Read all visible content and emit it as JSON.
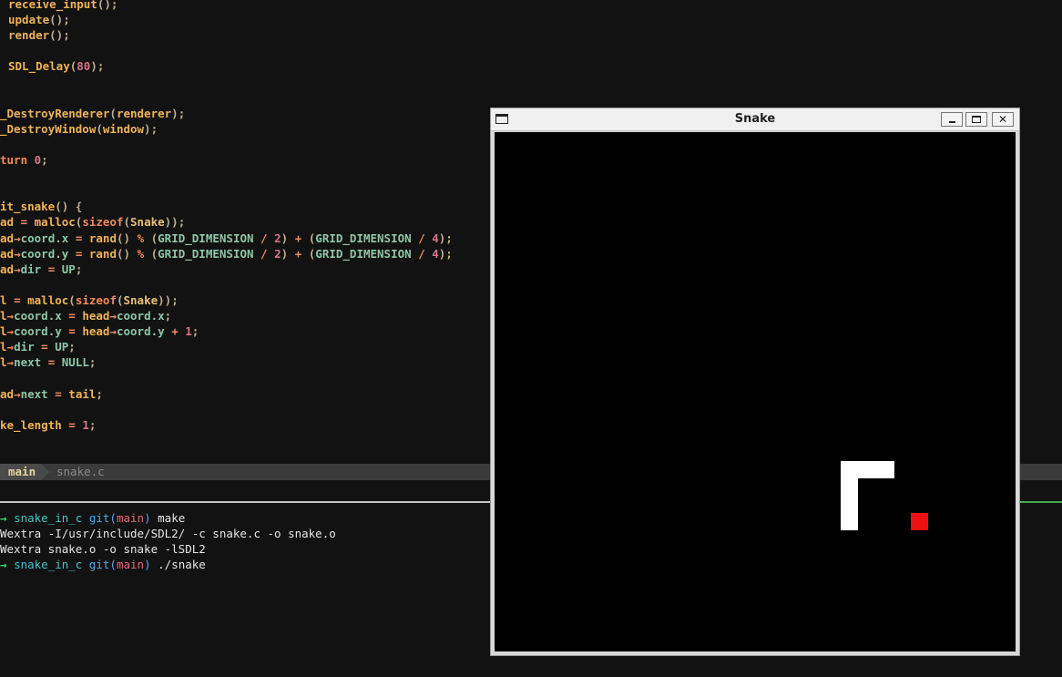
{
  "editor": {
    "lines": [
      [
        [
          "tok-fn",
          "receive_input"
        ],
        [
          "tok-pun",
          "();"
        ]
      ],
      [
        [
          "tok-fn",
          "update"
        ],
        [
          "tok-pun",
          "();"
        ]
      ],
      [
        [
          "tok-fn",
          "render"
        ],
        [
          "tok-pun",
          "();"
        ]
      ],
      [],
      [
        [
          "tok-fn",
          "SDL_Delay"
        ],
        [
          "tok-pun",
          "("
        ],
        [
          "tok-num",
          "80"
        ],
        [
          "tok-pun",
          ");"
        ]
      ],
      [],
      [],
      [
        [
          "tok-fn",
          "_DestroyRenderer"
        ],
        [
          "tok-pun",
          "("
        ],
        [
          "tok-id",
          "renderer"
        ],
        [
          "tok-pun",
          ");"
        ]
      ],
      [
        [
          "tok-fn",
          "_DestroyWindow"
        ],
        [
          "tok-pun",
          "("
        ],
        [
          "tok-id",
          "window"
        ],
        [
          "tok-pun",
          ");"
        ]
      ],
      [],
      [
        [
          "tok-kw",
          "turn "
        ],
        [
          "tok-num",
          "0"
        ],
        [
          "tok-pun",
          ";"
        ]
      ],
      [],
      [],
      [
        [
          "tok-fn",
          "it_snake"
        ],
        [
          "tok-pun",
          "() {"
        ]
      ],
      [
        [
          "tok-id",
          "ad "
        ],
        [
          "tok-op",
          "= "
        ],
        [
          "tok-fn",
          "malloc"
        ],
        [
          "tok-pun",
          "("
        ],
        [
          "tok-kw",
          "sizeof"
        ],
        [
          "tok-pun",
          "("
        ],
        [
          "tok-type",
          "Snake"
        ],
        [
          "tok-pun",
          "));"
        ]
      ],
      [
        [
          "tok-id",
          "ad"
        ],
        [
          "tok-op",
          "→"
        ],
        [
          "tok-mem",
          "coord.x "
        ],
        [
          "tok-op",
          "= "
        ],
        [
          "tok-fn",
          "rand"
        ],
        [
          "tok-pun",
          "() "
        ],
        [
          "tok-op",
          "% "
        ],
        [
          "tok-pun",
          "("
        ],
        [
          "tok-const",
          "GRID_DIMENSION "
        ],
        [
          "tok-op",
          "/ "
        ],
        [
          "tok-num",
          "2"
        ],
        [
          "tok-pun",
          ") "
        ],
        [
          "tok-op",
          "+ "
        ],
        [
          "tok-pun",
          "("
        ],
        [
          "tok-const",
          "GRID_DIMENSION "
        ],
        [
          "tok-op",
          "/ "
        ],
        [
          "tok-num",
          "4"
        ],
        [
          "tok-pun",
          ");"
        ]
      ],
      [
        [
          "tok-id",
          "ad"
        ],
        [
          "tok-op",
          "→"
        ],
        [
          "tok-mem",
          "coord.y "
        ],
        [
          "tok-op",
          "= "
        ],
        [
          "tok-fn",
          "rand"
        ],
        [
          "tok-pun",
          "() "
        ],
        [
          "tok-op",
          "% "
        ],
        [
          "tok-pun",
          "("
        ],
        [
          "tok-const",
          "GRID_DIMENSION "
        ],
        [
          "tok-op",
          "/ "
        ],
        [
          "tok-num",
          "2"
        ],
        [
          "tok-pun",
          ") "
        ],
        [
          "tok-op",
          "+ "
        ],
        [
          "tok-pun",
          "("
        ],
        [
          "tok-const",
          "GRID_DIMENSION "
        ],
        [
          "tok-op",
          "/ "
        ],
        [
          "tok-num",
          "4"
        ],
        [
          "tok-pun",
          ");"
        ]
      ],
      [
        [
          "tok-id",
          "ad"
        ],
        [
          "tok-op",
          "→"
        ],
        [
          "tok-mem",
          "dir "
        ],
        [
          "tok-op",
          "= "
        ],
        [
          "tok-const",
          "UP"
        ],
        [
          "tok-pun",
          ";"
        ]
      ],
      [],
      [
        [
          "tok-id",
          "l "
        ],
        [
          "tok-op",
          "= "
        ],
        [
          "tok-fn",
          "malloc"
        ],
        [
          "tok-pun",
          "("
        ],
        [
          "tok-kw",
          "sizeof"
        ],
        [
          "tok-pun",
          "("
        ],
        [
          "tok-type",
          "Snake"
        ],
        [
          "tok-pun",
          "));"
        ]
      ],
      [
        [
          "tok-id",
          "l"
        ],
        [
          "tok-op",
          "→"
        ],
        [
          "tok-mem",
          "coord.x "
        ],
        [
          "tok-op",
          "= "
        ],
        [
          "tok-id",
          "head"
        ],
        [
          "tok-op",
          "→"
        ],
        [
          "tok-mem",
          "coord.x"
        ],
        [
          "tok-pun",
          ";"
        ]
      ],
      [
        [
          "tok-id",
          "l"
        ],
        [
          "tok-op",
          "→"
        ],
        [
          "tok-mem",
          "coord.y "
        ],
        [
          "tok-op",
          "= "
        ],
        [
          "tok-id",
          "head"
        ],
        [
          "tok-op",
          "→"
        ],
        [
          "tok-mem",
          "coord.y "
        ],
        [
          "tok-op",
          "+ "
        ],
        [
          "tok-num",
          "1"
        ],
        [
          "tok-pun",
          ";"
        ]
      ],
      [
        [
          "tok-id",
          "l"
        ],
        [
          "tok-op",
          "→"
        ],
        [
          "tok-mem",
          "dir "
        ],
        [
          "tok-op",
          "= "
        ],
        [
          "tok-const",
          "UP"
        ],
        [
          "tok-pun",
          ";"
        ]
      ],
      [
        [
          "tok-id",
          "l"
        ],
        [
          "tok-op",
          "→"
        ],
        [
          "tok-mem",
          "next "
        ],
        [
          "tok-op",
          "= "
        ],
        [
          "tok-const",
          "NULL"
        ],
        [
          "tok-pun",
          ";"
        ]
      ],
      [],
      [
        [
          "tok-id",
          "ad"
        ],
        [
          "tok-op",
          "→"
        ],
        [
          "tok-mem",
          "next "
        ],
        [
          "tok-op",
          "= "
        ],
        [
          "tok-id",
          "tail"
        ],
        [
          "tok-pun",
          ";"
        ]
      ],
      [],
      [
        [
          "tok-id",
          "ke_length "
        ],
        [
          "tok-op",
          "= "
        ],
        [
          "tok-num",
          "1"
        ],
        [
          "tok-pun",
          ";"
        ]
      ]
    ]
  },
  "statusline": {
    "mode": "main",
    "file": "snake.c"
  },
  "terminal": {
    "lines": [
      [
        [
          "t-arrow",
          "→ "
        ],
        [
          "t-dir",
          "snake_in_c "
        ],
        [
          "t-git",
          "git("
        ],
        [
          "t-branch",
          "main"
        ],
        [
          "t-git",
          ") "
        ],
        [
          "t-cmd",
          "make"
        ]
      ],
      [
        [
          "t-cmd",
          "Wextra -I/usr/include/SDL2/ -c snake.c -o snake.o"
        ]
      ],
      [
        [
          "t-cmd",
          "Wextra snake.o -o snake -lSDL2"
        ]
      ],
      [
        [
          "t-arrow",
          "→ "
        ],
        [
          "t-dir",
          "snake_in_c "
        ],
        [
          "t-git",
          "git("
        ],
        [
          "t-branch",
          "main"
        ],
        [
          "t-git",
          ") "
        ],
        [
          "t-cmd",
          "./snake"
        ]
      ]
    ]
  },
  "snake_window": {
    "title": "Snake",
    "buttons": {
      "minimize": "",
      "maximize": "",
      "close": "✕"
    },
    "colors": {
      "background": "#000000",
      "snake": "#ffffff",
      "food": "#ee1111"
    }
  }
}
